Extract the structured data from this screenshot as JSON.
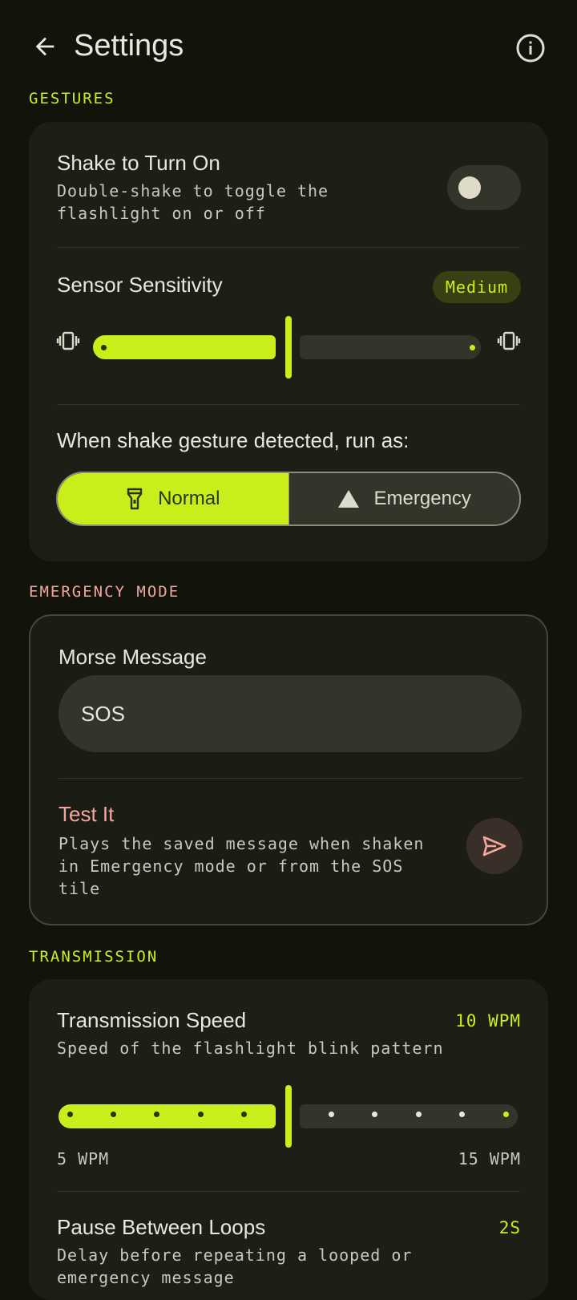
{
  "app": {
    "title": "Settings"
  },
  "icons": {
    "back": "arrow-left-icon",
    "info": "info-icon",
    "vibrate": "vibrate-icon",
    "flashlight": "flashlight-icon",
    "warning": "warning-triangle-icon",
    "send": "send-icon"
  },
  "colors": {
    "accent": "#c8ef1c",
    "emergency_accent": "#f2a69c",
    "background": "#12140c",
    "card": "#1d1f16"
  },
  "gestures": {
    "section_label": "GESTURES",
    "shake": {
      "title": "Shake to Turn On",
      "subtitle": "Double-shake to toggle the flashlight on or off",
      "enabled": false
    },
    "sensitivity": {
      "title": "Sensor Sensitivity",
      "value_label": "Medium",
      "level": 0.5
    },
    "run_as": {
      "title": "When shake gesture detected, run as:",
      "options": [
        "Normal",
        "Emergency"
      ],
      "selected": "Normal"
    }
  },
  "emergency": {
    "section_label": "EMERGENCY MODE",
    "morse": {
      "title": "Morse Message",
      "value": "SOS"
    },
    "test": {
      "title": "Test It",
      "subtitle": "Plays the saved message when shaken in Emergency mode or from the SOS tile"
    }
  },
  "transmission": {
    "section_label": "TRANSMISSION",
    "speed": {
      "title": "Transmission Speed",
      "value_label": "10 WPM",
      "subtitle": "Speed of the flashlight blink pattern",
      "min_label": "5 WPM",
      "max_label": "15 WPM",
      "min": 5,
      "max": 15,
      "value": 10
    },
    "pause": {
      "title": "Pause Between Loops",
      "value_label": "2S",
      "subtitle": "Delay before repeating a looped or emergency message"
    }
  }
}
